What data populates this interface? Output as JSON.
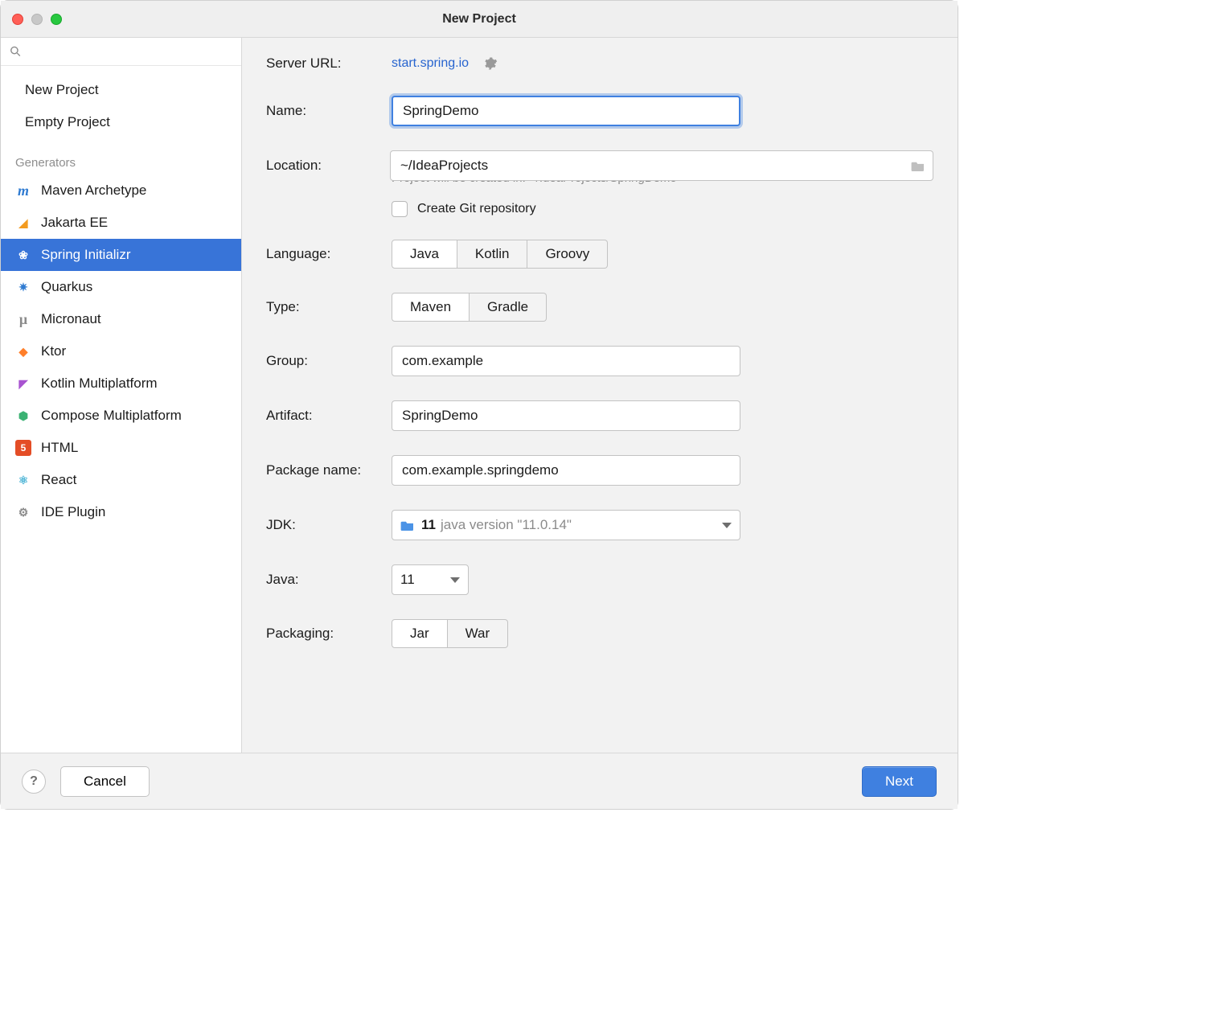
{
  "window": {
    "title": "New Project"
  },
  "sidebar": {
    "search_placeholder": "",
    "top_items": [
      {
        "label": "New Project"
      },
      {
        "label": "Empty Project"
      }
    ],
    "generators_header": "Generators",
    "generators": [
      {
        "label": "Maven Archetype",
        "icon": "maven"
      },
      {
        "label": "Jakarta EE",
        "icon": "jakarta"
      },
      {
        "label": "Spring Initializr",
        "icon": "spring",
        "selected": true
      },
      {
        "label": "Quarkus",
        "icon": "quarkus"
      },
      {
        "label": "Micronaut",
        "icon": "micronaut"
      },
      {
        "label": "Ktor",
        "icon": "ktor"
      },
      {
        "label": "Kotlin Multiplatform",
        "icon": "kotlin"
      },
      {
        "label": "Compose Multiplatform",
        "icon": "compose"
      },
      {
        "label": "HTML",
        "icon": "html"
      },
      {
        "label": "React",
        "icon": "react"
      },
      {
        "label": "IDE Plugin",
        "icon": "ideplugin"
      }
    ]
  },
  "form": {
    "server_url": {
      "label": "Server URL:",
      "value": "start.spring.io"
    },
    "name": {
      "label": "Name:",
      "value": "SpringDemo"
    },
    "location": {
      "label": "Location:",
      "value": "~/IdeaProjects",
      "hint": "Project will be created in: ~/IdeaProjects/SpringDemo"
    },
    "create_git": {
      "label": "Create Git repository",
      "checked": false
    },
    "language": {
      "label": "Language:",
      "options": [
        "Java",
        "Kotlin",
        "Groovy"
      ],
      "selected": "Java"
    },
    "type": {
      "label": "Type:",
      "options": [
        "Maven",
        "Gradle"
      ],
      "selected": "Maven"
    },
    "group": {
      "label": "Group:",
      "value": "com.example"
    },
    "artifact": {
      "label": "Artifact:",
      "value": "SpringDemo"
    },
    "package_name": {
      "label": "Package name:",
      "value": "com.example.springdemo"
    },
    "jdk": {
      "label": "JDK:",
      "value": "11",
      "detail": "java version \"11.0.14\""
    },
    "java": {
      "label": "Java:",
      "value": "11"
    },
    "packaging": {
      "label": "Packaging:",
      "options": [
        "Jar",
        "War"
      ],
      "selected": "Jar"
    }
  },
  "footer": {
    "help_symbol": "?",
    "cancel": "Cancel",
    "next": "Next"
  }
}
